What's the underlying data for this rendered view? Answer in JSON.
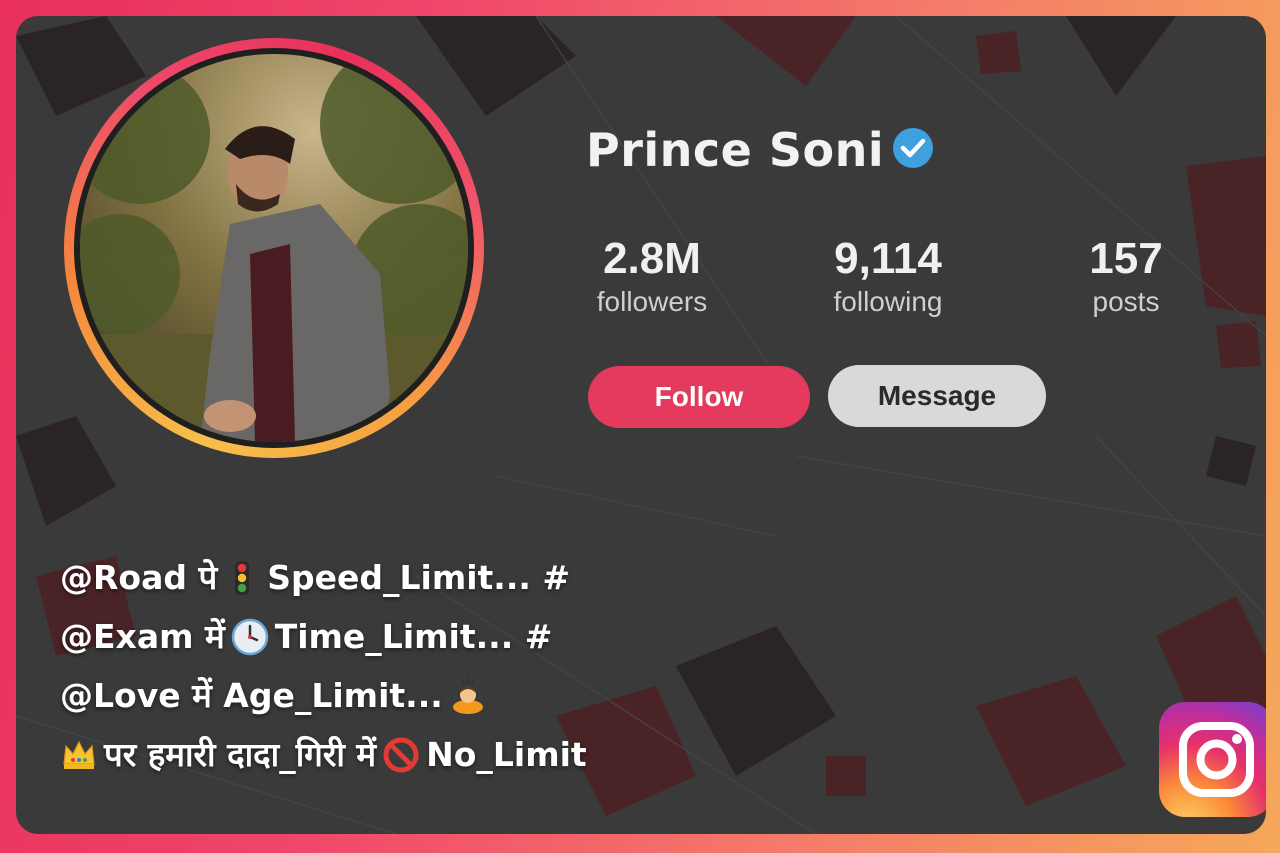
{
  "profile": {
    "name": "Prince Soni",
    "verified_icon": "verified-badge-icon",
    "stats": [
      {
        "value": "2.8M",
        "label": "followers"
      },
      {
        "value": "9,114",
        "label": "following"
      },
      {
        "value": "157",
        "label": "posts"
      }
    ],
    "follow_label": "Follow",
    "message_label": "Message"
  },
  "caption": {
    "line1": {
      "a": "@Road पे",
      "b": "Speed_Limit... #",
      "emoji": "traffic-light-icon"
    },
    "line2": {
      "a": "@Exam में",
      "b": "Time_Limit... #",
      "emoji": "clock-icon"
    },
    "line3": {
      "a": "@Love में Age_Limit...",
      "emoji": "bowing-person-icon"
    },
    "line4": {
      "a": "पर हमारी दादा_गिरी में",
      "b": "No_Limit",
      "emoji_start": "crown-icon",
      "emoji": "prohibited-icon"
    }
  },
  "branding": {
    "logo": "instagram-logo-icon"
  },
  "colors": {
    "follow_button": "#e33a5e",
    "message_button": "#d9d9d9",
    "frame_start": "#e8305a",
    "frame_end": "#f5a85a",
    "verified": "#3fa0e0",
    "panel_bg": "#3a3a3a"
  }
}
